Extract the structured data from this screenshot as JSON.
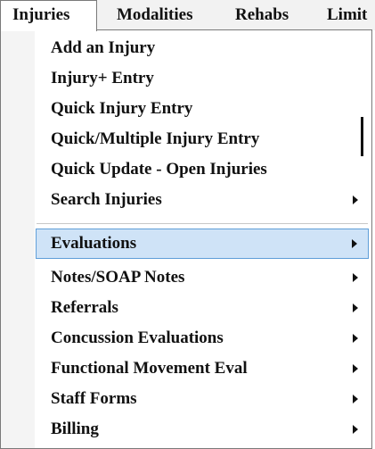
{
  "menubar": {
    "items": [
      {
        "label": "Injuries"
      },
      {
        "label": "Modalities"
      },
      {
        "label": "Rehabs"
      },
      {
        "label": "Limit"
      }
    ]
  },
  "dropdown": {
    "items": [
      {
        "label": "Add an Injury",
        "submenu": false
      },
      {
        "label": "Injury+ Entry",
        "submenu": false
      },
      {
        "label": "Quick Injury Entry",
        "submenu": false
      },
      {
        "label": "Quick/Multiple Injury Entry",
        "submenu": false
      },
      {
        "label": "Quick Update - Open Injuries",
        "submenu": false
      },
      {
        "label": "Search Injuries",
        "submenu": true
      },
      {
        "label": "Evaluations",
        "submenu": true,
        "highlighted": true
      },
      {
        "label": "Notes/SOAP Notes",
        "submenu": true
      },
      {
        "label": "Referrals",
        "submenu": true
      },
      {
        "label": "Concussion Evaluations",
        "submenu": true
      },
      {
        "label": "Functional Movement Eval",
        "submenu": true
      },
      {
        "label": "Staff Forms",
        "submenu": true
      },
      {
        "label": "Billing",
        "submenu": true
      }
    ],
    "highlight_color": "#cfe3f7",
    "highlight_border_color": "#5f9ed8"
  }
}
